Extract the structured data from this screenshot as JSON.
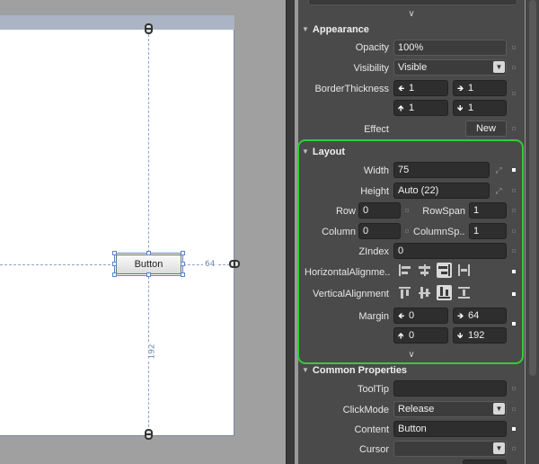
{
  "canvas": {
    "button_label": "Button",
    "margin_right_value": "64",
    "margin_bottom_value": "192"
  },
  "appearance": {
    "header": "Appearance",
    "opacity_label": "Opacity",
    "opacity_value": "100%",
    "visibility_label": "Visibility",
    "visibility_value": "Visible",
    "border_label": "BorderThickness",
    "border_left": "1",
    "border_right": "1",
    "border_top": "1",
    "border_bottom": "1",
    "effect_label": "Effect",
    "effect_button": "New"
  },
  "layout": {
    "header": "Layout",
    "width_label": "Width",
    "width_value": "75",
    "height_label": "Height",
    "height_value": "Auto (22)",
    "row_label": "Row",
    "row_value": "0",
    "rowspan_label": "RowSpan",
    "rowspan_value": "1",
    "column_label": "Column",
    "column_value": "0",
    "columnspan_label": "ColumnSp...",
    "columnspan_value": "1",
    "zindex_label": "ZIndex",
    "zindex_value": "0",
    "halign_label": "HorizontalAlignme...",
    "valign_label": "VerticalAlignment",
    "margin_label": "Margin",
    "margin_left": "0",
    "margin_right": "64",
    "margin_top": "0",
    "margin_bottom": "192",
    "accent_color": "#35cc35"
  },
  "common": {
    "header": "Common Properties",
    "tooltip_label": "ToolTip",
    "tooltip_value": "",
    "clickmode_label": "ClickMode",
    "clickmode_value": "Release",
    "content_label": "Content",
    "content_value": "Button",
    "cursor_label": "Cursor",
    "cursor_value": ""
  }
}
